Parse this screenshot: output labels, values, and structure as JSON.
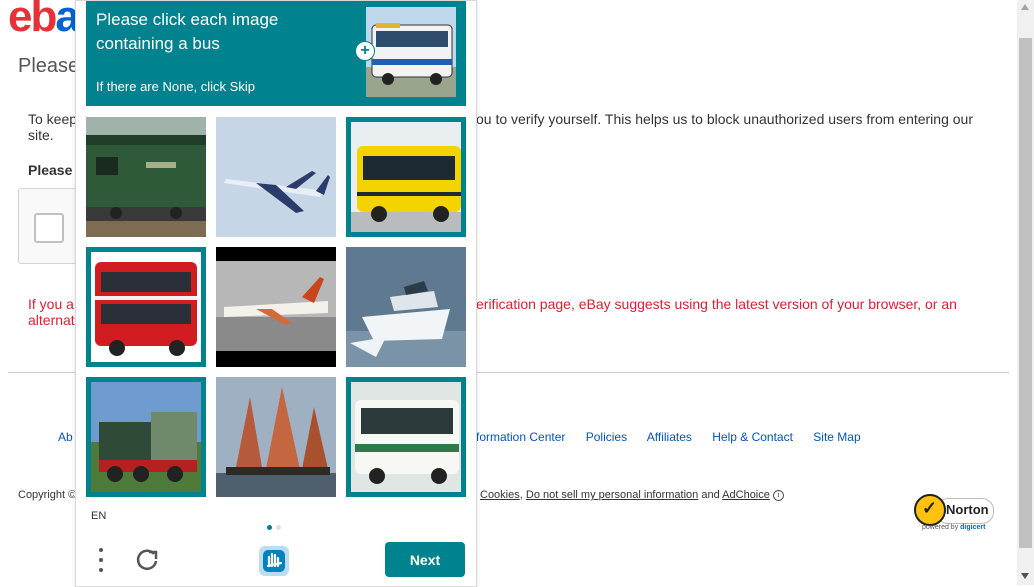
{
  "page": {
    "logo_e": "eb",
    "logo_b": "a",
    "heading": "Please",
    "intro_left": "To keep",
    "intro_left2": "site.",
    "intro_right": "ou to verify yourself. This helps us to block unauthorized users from entering our",
    "please_label": "Please",
    "warn_left": "If you a",
    "warn_left2": "alternat",
    "warn_right": "erification page, eBay suggests using the latest version of your browser, or an"
  },
  "footer": {
    "left_link": "Ab",
    "links": [
      "formation Center",
      "Policies",
      "Affiliates",
      "Help & Contact",
      "Site Map"
    ],
    "copyright": "Copyright ©",
    "legal_cookies": "Cookies",
    "legal_dnsmpi": "Do not sell my personal information",
    "legal_and": "and",
    "legal_adchoice": "AdChoice",
    "norton_brand": "Norton",
    "norton_powered": "powered by",
    "norton_digicert": "digicert"
  },
  "challenge": {
    "prompt_title": "Please click each image containing a bus",
    "prompt_sub": "If there are None, click Skip",
    "language": "EN",
    "next_label": "Next",
    "tiles": [
      {
        "name": "train-green",
        "selected": false
      },
      {
        "name": "airplane",
        "selected": false
      },
      {
        "name": "bus-yellow",
        "selected": true
      },
      {
        "name": "bus-red-double-decker",
        "selected": true
      },
      {
        "name": "airplane-runway",
        "selected": false
      },
      {
        "name": "speedboat",
        "selected": false
      },
      {
        "name": "steam-train",
        "selected": true
      },
      {
        "name": "sailboats",
        "selected": false
      },
      {
        "name": "bus-white",
        "selected": true
      }
    ],
    "page_indicator": {
      "current": 1,
      "total": 2
    }
  },
  "colors": {
    "accent": "#00838f",
    "ebay_red": "#e53238",
    "ebay_blue": "#0064d2",
    "link": "#0654ba",
    "warning": "#dd1e31"
  }
}
